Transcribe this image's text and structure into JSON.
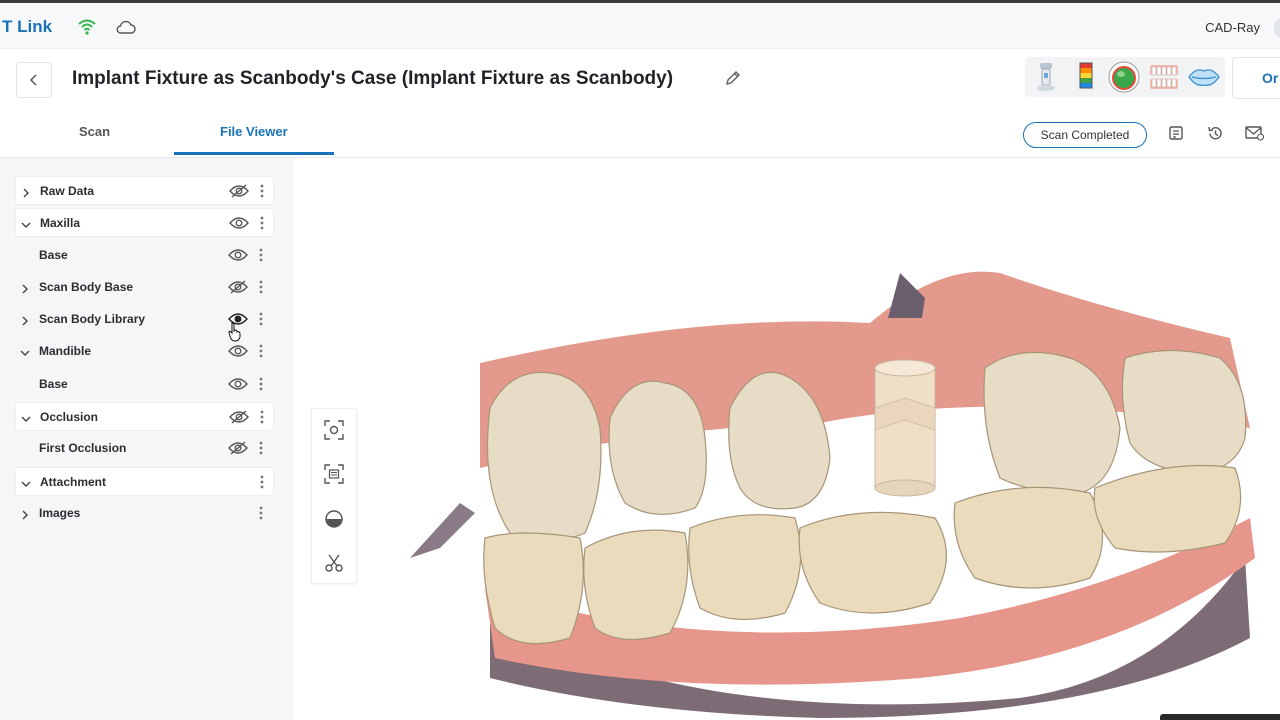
{
  "app": {
    "brand": "T Link",
    "user": "CAD-Ray"
  },
  "header": {
    "title": "Implant Fixture as Scanbody's Case (Implant Fixture as Scanbody)",
    "order_label": "Or",
    "tools": [
      "scanner-icon",
      "heatmap-icon",
      "sphere-icon",
      "teeth-icon",
      "lips-icon"
    ]
  },
  "tabs": [
    {
      "label": "Scan",
      "active": false
    },
    {
      "label": "File Viewer",
      "active": true
    }
  ],
  "status": {
    "label": "Scan Completed"
  },
  "tree": [
    {
      "label": "Raw Data",
      "expand": "collapsed",
      "eye": "hidden",
      "boxed": true
    },
    {
      "label": "Maxilla",
      "expand": "expanded",
      "eye": "visible",
      "boxed": true
    },
    {
      "label": "Base",
      "expand": "none",
      "eye": "visible",
      "boxed": false
    },
    {
      "label": "Scan Body Base",
      "expand": "collapsed",
      "eye": "hidden",
      "boxed": false
    },
    {
      "label": "Scan Body Library",
      "expand": "collapsed",
      "eye": "visible-hover",
      "boxed": false
    },
    {
      "label": "Mandible",
      "expand": "expanded",
      "eye": "visible",
      "boxed": false
    },
    {
      "label": "Base",
      "expand": "none",
      "eye": "visible",
      "boxed": false
    },
    {
      "label": "Occlusion",
      "expand": "expanded",
      "eye": "hidden",
      "boxed": true
    },
    {
      "label": "First Occlusion",
      "expand": "none",
      "eye": "hidden",
      "boxed": false
    },
    {
      "label": "Attachment",
      "expand": "expanded",
      "eye": "none",
      "boxed": true
    },
    {
      "label": "Images",
      "expand": "collapsed",
      "eye": "none",
      "boxed": false
    }
  ],
  "viewer_tools": [
    "focus-icon",
    "fit-view-icon",
    "hemisphere-icon",
    "scissors-icon"
  ],
  "colors": {
    "accent": "#1a73b8",
    "wifi": "#2fb54a",
    "gingiva": "#e59a8e",
    "tooth": "#e8dcc2",
    "scanbody": "#f0dfc8"
  }
}
